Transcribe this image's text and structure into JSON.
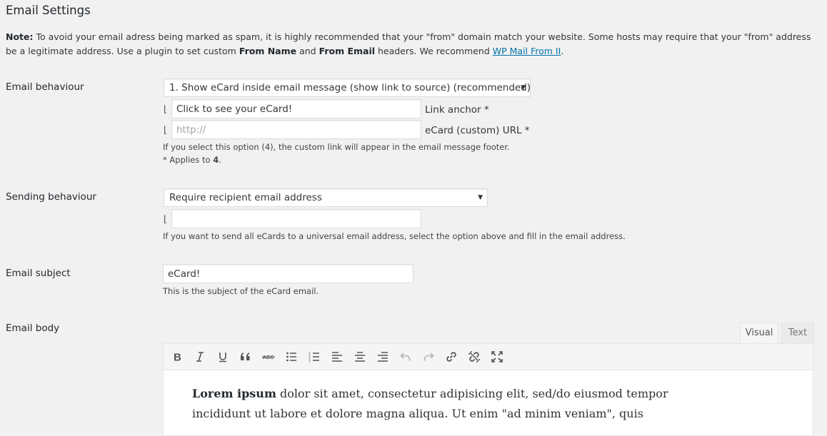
{
  "title": "Email Settings",
  "note": {
    "label": "Note:",
    "text1": " To avoid your email adress being marked as spam, it is highly recommended that your \"from\" domain match your website. Some hosts may require that your \"from\" address be a legitimate address. Use a plugin to set custom ",
    "from_name": "From Name",
    "and": " and ",
    "from_email": "From Email",
    "text2": " headers. We recommend ",
    "link": "WP Mail From II",
    "end": "."
  },
  "email_behaviour": {
    "label": "Email behaviour",
    "selected": "1. Show eCard inside email message (show link to source) (recommended)",
    "link_anchor_mark": "⌊",
    "link_anchor_value": "Click to see your eCard!",
    "link_anchor_label": "Link anchor *",
    "url_mark": "⌊",
    "url_placeholder": "http://",
    "url_value": "",
    "url_label": "eCard (custom) URL *",
    "desc1": "If you select this option (4), the custom link will appear in the email message footer.",
    "desc2_prefix": "* Applies to ",
    "desc2_bold": "4",
    "desc2_suffix": "."
  },
  "sending_behaviour": {
    "label": "Sending behaviour",
    "selected": "Require recipient email address",
    "mark": "⌊",
    "value": "",
    "desc": "If you want to send all eCards to a universal email address, select the option above and fill in the email address."
  },
  "email_subject": {
    "label": "Email subject",
    "value": "eCard!",
    "desc": "This is the subject of the eCard email."
  },
  "email_body": {
    "label": "Email body",
    "tabs": [
      "Visual",
      "Text"
    ],
    "active_tab": "Visual",
    "toolbar": [
      "bold-icon",
      "italic-icon",
      "underline-icon",
      "blockquote-icon",
      "strikethrough-icon",
      "bulleted-list-icon",
      "numbered-list-icon",
      "align-left-icon",
      "align-center-icon",
      "align-right-icon",
      "undo-icon",
      "redo-icon",
      "link-icon",
      "unlink-icon",
      "fullscreen-icon"
    ],
    "content_bold": "Lorem ipsum",
    "content_rest": " dolor sit amet, consectetur adipisicing elit, sed/do eiusmod tempor incididunt ut labore et dolore magna aliqua. Ut enim \"ad minim veniam\", quis"
  },
  "colors": {
    "background": "#f1f1f1",
    "link": "#0073aa",
    "text": "#23282d"
  }
}
